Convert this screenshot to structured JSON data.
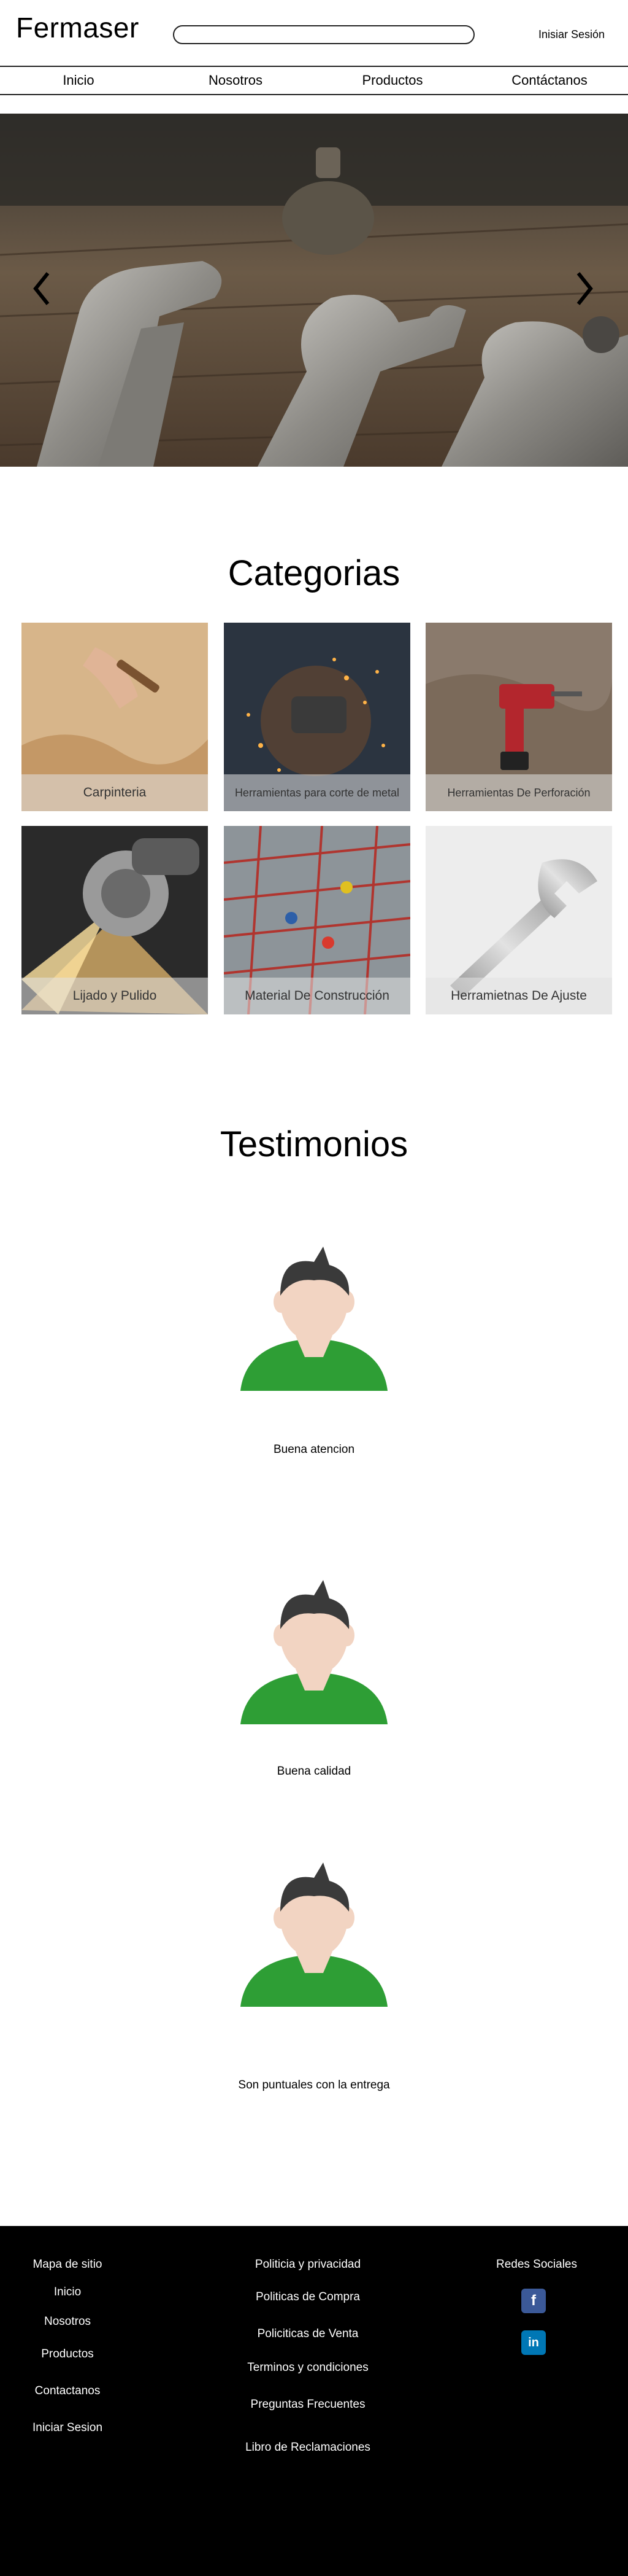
{
  "header": {
    "brand": "Fermaser",
    "search_placeholder": "",
    "login": "Inisiar Sesión"
  },
  "nav": {
    "items": [
      "Inicio",
      "Nosotros",
      "Productos",
      "Contáctanos"
    ]
  },
  "hero": {
    "prev_icon": "chevron-left-icon",
    "next_icon": "chevron-right-icon"
  },
  "categories": {
    "title": "Categorias",
    "items": [
      {
        "label": "Carpinteria"
      },
      {
        "label": "Herramientas para corte de metal"
      },
      {
        "label": "Herramientas De Perforación"
      },
      {
        "label": "Lijado y Pulido"
      },
      {
        "label": "Material De Construcción"
      },
      {
        "label": "Herramietnas De Ajuste"
      }
    ]
  },
  "testimonials": {
    "title": "Testimonios",
    "items": [
      {
        "text": "Buena atencion"
      },
      {
        "text": "Buena calidad"
      },
      {
        "text": "Son puntuales con la entrega"
      }
    ]
  },
  "footer": {
    "col1": {
      "heading": "Mapa de sitio",
      "links": [
        "Inicio",
        "Nosotros",
        "Productos",
        "Contactanos",
        "Iniciar Sesion"
      ]
    },
    "col2": {
      "heading": "Politicia y privacidad",
      "links": [
        "Politicas de Compra",
        "Policiticas de Venta",
        "Terminos y condiciones",
        "Preguntas Frecuentes",
        "Libro de Reclamaciones"
      ]
    },
    "col3": {
      "heading": "Redes Sociales",
      "facebook": "f",
      "linkedin": "in"
    },
    "colors": {
      "facebook": "#3b5998",
      "linkedin": "#0077b5"
    }
  }
}
